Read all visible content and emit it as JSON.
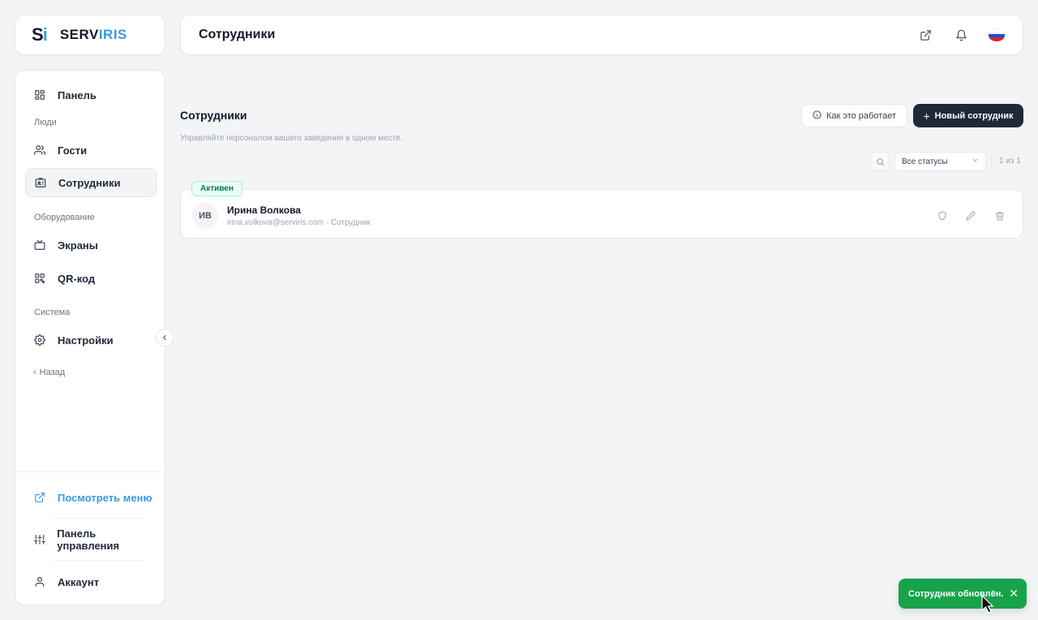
{
  "brand": {
    "mark_s": "S",
    "mark_i": "i",
    "name_part1": "SERV",
    "name_part2": "IRIS",
    "accent_color": "#3b9ae1"
  },
  "header": {
    "title": "Сотрудники",
    "icons": [
      "external-link-icon",
      "bell-icon",
      "russia-flag-icon"
    ]
  },
  "sidebar": {
    "items": [
      {
        "label": "Панель",
        "icon": "dashboard-grid-icon"
      },
      {
        "label": "Гости",
        "icon": "users-icon"
      },
      {
        "label": "Сотрудники",
        "icon": "id-card-icon",
        "active": true
      },
      {
        "label": "Экраны",
        "icon": "tv-icon"
      },
      {
        "label": "QR-код",
        "icon": "qr-code-icon"
      },
      {
        "label": "Настройки",
        "icon": "gear-icon"
      }
    ],
    "sections": {
      "people": "Люди",
      "equipment": "Оборудование",
      "system": "Система"
    },
    "back_label": "Назад",
    "bottom": {
      "view_menu": "Посмотреть меню",
      "control_panel": "Панель управления",
      "account": "Аккаунт"
    }
  },
  "main": {
    "title": "Сотрудники",
    "subtitle": "Управляйте персоналом вашего заведения в одном месте.",
    "how_it_works": "Как это работает",
    "new_employee": "Новый сотрудник",
    "status_filter": "Все статусы",
    "pager": "1 из 1",
    "employees": [
      {
        "initials": "ИВ",
        "name": "Ирина Волкова",
        "meta": "irina.volkova@serviris.com · Сотрудник",
        "status": "Активен"
      }
    ]
  },
  "toast": {
    "message": "Сотрудник обновлён.",
    "close": "✕",
    "color": "#16a34a"
  }
}
